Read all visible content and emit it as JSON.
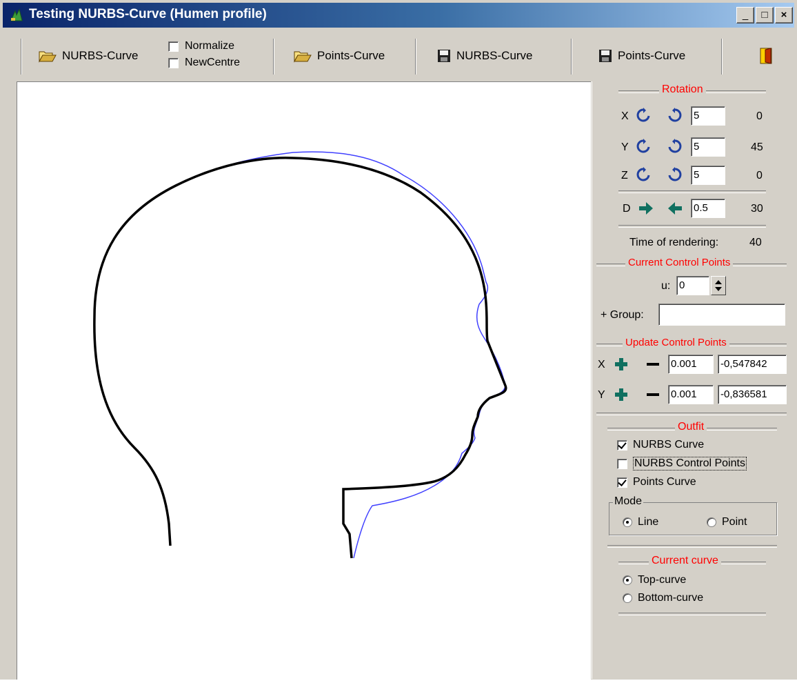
{
  "window": {
    "title": "Testing NURBS-Curve (Humen profile)",
    "buttons": {
      "minimize": "_",
      "maximize": "□",
      "close": "×"
    }
  },
  "toolbar": {
    "open_nurbs_label": "NURBS-Curve",
    "normalize_label": "Normalize",
    "newcentre_label": "NewCentre",
    "open_points_label": "Points-Curve",
    "save_nurbs_label": "NURBS-Curve",
    "save_points_label": "Points-Curve"
  },
  "rotation": {
    "title": "Rotation",
    "x": {
      "axis": "X",
      "step": "5",
      "value": "0"
    },
    "y": {
      "axis": "Y",
      "step": "5",
      "value": "45"
    },
    "z": {
      "axis": "Z",
      "step": "5",
      "value": "0"
    },
    "d": {
      "axis": "D",
      "step": "0.5",
      "value": "30"
    }
  },
  "rendering": {
    "label": "Time of rendering:",
    "value": "40"
  },
  "current_cp": {
    "title": "Current Control Points",
    "u_label": "u:",
    "u_value": "0",
    "group_label": "+ Group:",
    "group_value": ""
  },
  "update_cp": {
    "title": "Update Control Points",
    "x": {
      "axis": "X",
      "step": "0.001",
      "value": "-0,547842"
    },
    "y": {
      "axis": "Y",
      "step": "0.001",
      "value": "-0,836581"
    }
  },
  "outfit": {
    "title": "Outfit",
    "nurbs_curve": {
      "label": "NURBS Curve",
      "checked": true
    },
    "nurbs_cp": {
      "label": "NURBS Control Points",
      "checked": false
    },
    "points_curve": {
      "label": "Points Curve",
      "checked": true
    },
    "mode": {
      "title": "Mode",
      "line": "Line",
      "point": "Point",
      "selected": "Line"
    }
  },
  "current_curve": {
    "title": "Current curve",
    "top": "Top-curve",
    "bottom": "Bottom-curve",
    "selected": "Top-curve"
  },
  "colors": {
    "nurbs_curve": "#000000",
    "points_curve": "#4040ff",
    "group_title": "#ff0000"
  }
}
